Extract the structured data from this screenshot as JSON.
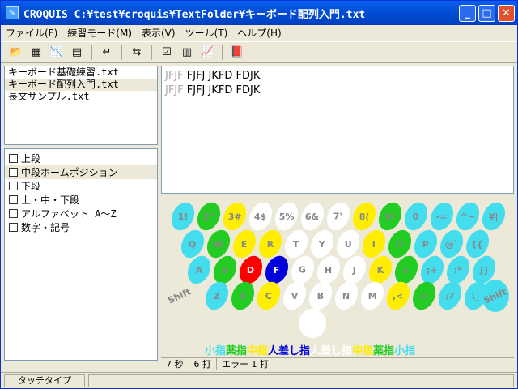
{
  "window": {
    "title": "CROQUIS  C:¥test¥croquis¥TextFolder¥キーボード配列入門.txt",
    "minimize": "_",
    "maximize": "□",
    "close": "✕"
  },
  "menu": [
    {
      "label": "ファイル(F)"
    },
    {
      "label": "練習モード(M)"
    },
    {
      "label": "表示(V)"
    },
    {
      "label": "ツール(T)"
    },
    {
      "label": "ヘルプ(H)"
    }
  ],
  "toolbar": [
    {
      "name": "open-folder-icon",
      "glyph": "📂"
    },
    {
      "name": "grid-icon",
      "glyph": "▦"
    },
    {
      "name": "chart-icon",
      "glyph": "📉"
    },
    {
      "name": "keyboard-icon",
      "glyph": "▤"
    },
    {
      "sep": true
    },
    {
      "name": "enter-icon",
      "glyph": "↵"
    },
    {
      "sep": true
    },
    {
      "name": "replace-icon",
      "glyph": "⇆"
    },
    {
      "sep": true
    },
    {
      "name": "checklist-icon",
      "glyph": "☑"
    },
    {
      "name": "table-icon",
      "glyph": "▥"
    },
    {
      "name": "graph-icon",
      "glyph": "📈"
    },
    {
      "sep": true
    },
    {
      "name": "book-icon",
      "glyph": "📕"
    }
  ],
  "files": [
    {
      "name": "キーボード基礎練習.txt",
      "selected": false
    },
    {
      "name": "キーボード配列入門.txt",
      "selected": true
    },
    {
      "name": "長文サンプル.txt",
      "selected": false
    }
  ],
  "lessons": [
    {
      "label": "上段",
      "selected": false
    },
    {
      "label": "中段ホームポジション",
      "selected": true
    },
    {
      "label": "下段",
      "selected": false
    },
    {
      "label": "上・中・下段",
      "selected": false
    },
    {
      "label": "アルファベット A～Z",
      "selected": false
    },
    {
      "label": "数字・記号",
      "selected": false
    }
  ],
  "text_lines": [
    {
      "typed": "JFJF",
      "rest": " FJFJ JKFD FDJK"
    },
    {
      "typed": "JFJF",
      "rest": " FJFJ JKFD FDJK"
    }
  ],
  "keyboard": {
    "rows": [
      [
        "1!",
        "2\"",
        "3#",
        "4$",
        "5%",
        "6&",
        "7'",
        "8(",
        "9)",
        "0",
        "-=",
        "^~",
        "¥|"
      ],
      [
        "Q",
        "W",
        "E",
        "R",
        "T",
        "Y",
        "U",
        "I",
        "O",
        "P",
        "@`",
        "[{"
      ],
      [
        "A",
        "S",
        "D",
        "F",
        "G",
        "H",
        "J",
        "K",
        "L",
        ";+",
        ":*",
        "]}"
      ],
      [
        "Z",
        "X",
        "C",
        "V",
        "B",
        "N",
        "M",
        ",<",
        ".>",
        "/?",
        "\\_"
      ]
    ],
    "shift_label": "Shift",
    "colors": {
      "cyan": "#44ddee",
      "green": "#22cc22",
      "yellow": "#ffee00",
      "white": "#ffffff",
      "red": "#ff0000",
      "blue": "#0000dd"
    },
    "row_colors": [
      [
        "cyan",
        "green",
        "yellow",
        "white",
        "white",
        "white",
        "white",
        "yellow",
        "green",
        "cyan",
        "cyan",
        "cyan",
        "cyan"
      ],
      [
        "cyan",
        "green",
        "yellow",
        "yellow",
        "white",
        "white",
        "white",
        "yellow",
        "green",
        "cyan",
        "cyan",
        "cyan"
      ],
      [
        "cyan",
        "green",
        "red",
        "blue",
        "white",
        "white",
        "white",
        "yellow",
        "green",
        "cyan",
        "cyan",
        "cyan"
      ],
      [
        "cyan",
        "green",
        "yellow",
        "white",
        "white",
        "white",
        "white",
        "yellow",
        "green",
        "cyan",
        "cyan"
      ]
    ]
  },
  "legend": [
    {
      "text": "小指",
      "color": "#44ddee"
    },
    {
      "text": "薬指",
      "color": "#22cc22"
    },
    {
      "text": "中指",
      "color": "#ffee00"
    },
    {
      "text": "人差し指",
      "color": "#0000dd"
    },
    {
      "text": "人差し指",
      "color": "#ffffff"
    },
    {
      "text": "中指",
      "color": "#ffee00"
    },
    {
      "text": "薬指",
      "color": "#22cc22"
    },
    {
      "text": "小指",
      "color": "#44ddee"
    }
  ],
  "stats": {
    "time": "7 秒",
    "strokes": "6 打",
    "errors": "エラー  1 打"
  },
  "status": {
    "mode": "タッチタイプ"
  }
}
